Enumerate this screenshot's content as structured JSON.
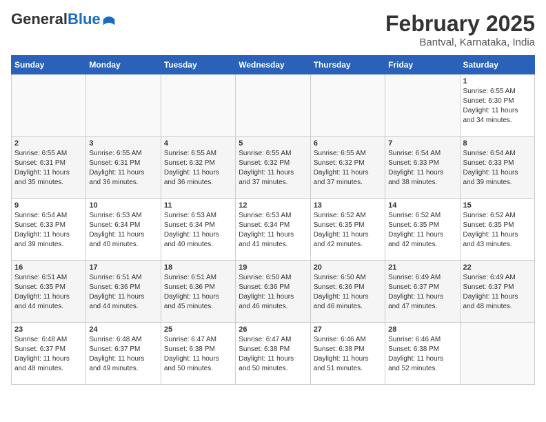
{
  "header": {
    "logo_general": "General",
    "logo_blue": "Blue",
    "main_title": "February 2025",
    "subtitle": "Bantval, Karnataka, India"
  },
  "weekdays": [
    "Sunday",
    "Monday",
    "Tuesday",
    "Wednesday",
    "Thursday",
    "Friday",
    "Saturday"
  ],
  "weeks": [
    [
      {
        "day": "",
        "info": ""
      },
      {
        "day": "",
        "info": ""
      },
      {
        "day": "",
        "info": ""
      },
      {
        "day": "",
        "info": ""
      },
      {
        "day": "",
        "info": ""
      },
      {
        "day": "",
        "info": ""
      },
      {
        "day": "1",
        "info": "Sunrise: 6:55 AM\nSunset: 6:30 PM\nDaylight: 11 hours\nand 34 minutes."
      }
    ],
    [
      {
        "day": "2",
        "info": "Sunrise: 6:55 AM\nSunset: 6:31 PM\nDaylight: 11 hours\nand 35 minutes."
      },
      {
        "day": "3",
        "info": "Sunrise: 6:55 AM\nSunset: 6:31 PM\nDaylight: 11 hours\nand 36 minutes."
      },
      {
        "day": "4",
        "info": "Sunrise: 6:55 AM\nSunset: 6:32 PM\nDaylight: 11 hours\nand 36 minutes."
      },
      {
        "day": "5",
        "info": "Sunrise: 6:55 AM\nSunset: 6:32 PM\nDaylight: 11 hours\nand 37 minutes."
      },
      {
        "day": "6",
        "info": "Sunrise: 6:55 AM\nSunset: 6:32 PM\nDaylight: 11 hours\nand 37 minutes."
      },
      {
        "day": "7",
        "info": "Sunrise: 6:54 AM\nSunset: 6:33 PM\nDaylight: 11 hours\nand 38 minutes."
      },
      {
        "day": "8",
        "info": "Sunrise: 6:54 AM\nSunset: 6:33 PM\nDaylight: 11 hours\nand 39 minutes."
      }
    ],
    [
      {
        "day": "9",
        "info": "Sunrise: 6:54 AM\nSunset: 6:33 PM\nDaylight: 11 hours\nand 39 minutes."
      },
      {
        "day": "10",
        "info": "Sunrise: 6:53 AM\nSunset: 6:34 PM\nDaylight: 11 hours\nand 40 minutes."
      },
      {
        "day": "11",
        "info": "Sunrise: 6:53 AM\nSunset: 6:34 PM\nDaylight: 11 hours\nand 40 minutes."
      },
      {
        "day": "12",
        "info": "Sunrise: 6:53 AM\nSunset: 6:34 PM\nDaylight: 11 hours\nand 41 minutes."
      },
      {
        "day": "13",
        "info": "Sunrise: 6:52 AM\nSunset: 6:35 PM\nDaylight: 11 hours\nand 42 minutes."
      },
      {
        "day": "14",
        "info": "Sunrise: 6:52 AM\nSunset: 6:35 PM\nDaylight: 11 hours\nand 42 minutes."
      },
      {
        "day": "15",
        "info": "Sunrise: 6:52 AM\nSunset: 6:35 PM\nDaylight: 11 hours\nand 43 minutes."
      }
    ],
    [
      {
        "day": "16",
        "info": "Sunrise: 6:51 AM\nSunset: 6:35 PM\nDaylight: 11 hours\nand 44 minutes."
      },
      {
        "day": "17",
        "info": "Sunrise: 6:51 AM\nSunset: 6:36 PM\nDaylight: 11 hours\nand 44 minutes."
      },
      {
        "day": "18",
        "info": "Sunrise: 6:51 AM\nSunset: 6:36 PM\nDaylight: 11 hours\nand 45 minutes."
      },
      {
        "day": "19",
        "info": "Sunrise: 6:50 AM\nSunset: 6:36 PM\nDaylight: 11 hours\nand 46 minutes."
      },
      {
        "day": "20",
        "info": "Sunrise: 6:50 AM\nSunset: 6:36 PM\nDaylight: 11 hours\nand 46 minutes."
      },
      {
        "day": "21",
        "info": "Sunrise: 6:49 AM\nSunset: 6:37 PM\nDaylight: 11 hours\nand 47 minutes."
      },
      {
        "day": "22",
        "info": "Sunrise: 6:49 AM\nSunset: 6:37 PM\nDaylight: 11 hours\nand 48 minutes."
      }
    ],
    [
      {
        "day": "23",
        "info": "Sunrise: 6:48 AM\nSunset: 6:37 PM\nDaylight: 11 hours\nand 48 minutes."
      },
      {
        "day": "24",
        "info": "Sunrise: 6:48 AM\nSunset: 6:37 PM\nDaylight: 11 hours\nand 49 minutes."
      },
      {
        "day": "25",
        "info": "Sunrise: 6:47 AM\nSunset: 6:38 PM\nDaylight: 11 hours\nand 50 minutes."
      },
      {
        "day": "26",
        "info": "Sunrise: 6:47 AM\nSunset: 6:38 PM\nDaylight: 11 hours\nand 50 minutes."
      },
      {
        "day": "27",
        "info": "Sunrise: 6:46 AM\nSunset: 6:38 PM\nDaylight: 11 hours\nand 51 minutes."
      },
      {
        "day": "28",
        "info": "Sunrise: 6:46 AM\nSunset: 6:38 PM\nDaylight: 11 hours\nand 52 minutes."
      },
      {
        "day": "",
        "info": ""
      }
    ]
  ]
}
